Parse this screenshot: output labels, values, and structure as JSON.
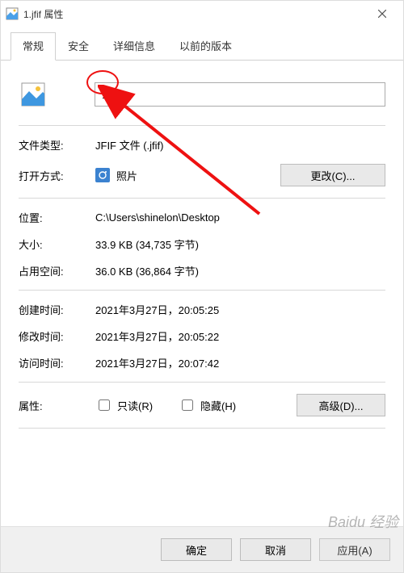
{
  "titlebar": {
    "icon": "file",
    "text": "1.jfif 属性"
  },
  "tabs": {
    "items": [
      {
        "label": "常规",
        "active": true
      },
      {
        "label": "安全",
        "active": false
      },
      {
        "label": "详细信息",
        "active": false
      },
      {
        "label": "以前的版本",
        "active": false
      }
    ]
  },
  "filename": {
    "value": "1.jpg"
  },
  "rows": {
    "filetype_label": "文件类型:",
    "filetype_value": "JFIF 文件 (.jfif)",
    "openwith_label": "打开方式:",
    "openwith_value": "照片",
    "change_btn": "更改(C)...",
    "location_label": "位置:",
    "location_value": "C:\\Users\\shinelon\\Desktop",
    "size_label": "大小:",
    "size_value": "33.9 KB (34,735 字节)",
    "sizeondisk_label": "占用空间:",
    "sizeondisk_value": "36.0 KB (36,864 字节)",
    "created_label": "创建时间:",
    "created_value": "2021年3月27日，20:05:25",
    "modified_label": "修改时间:",
    "modified_value": "2021年3月27日，20:05:22",
    "accessed_label": "访问时间:",
    "accessed_value": "2021年3月27日，20:07:42",
    "attrs_label": "属性:",
    "readonly_label": "只读(R)",
    "hidden_label": "隐藏(H)",
    "advanced_btn": "高级(D)..."
  },
  "footer": {
    "ok": "确定",
    "cancel": "取消",
    "apply": "应用(A)"
  },
  "watermark": "Baidu 经验",
  "annotation": {
    "color": "#e11"
  }
}
